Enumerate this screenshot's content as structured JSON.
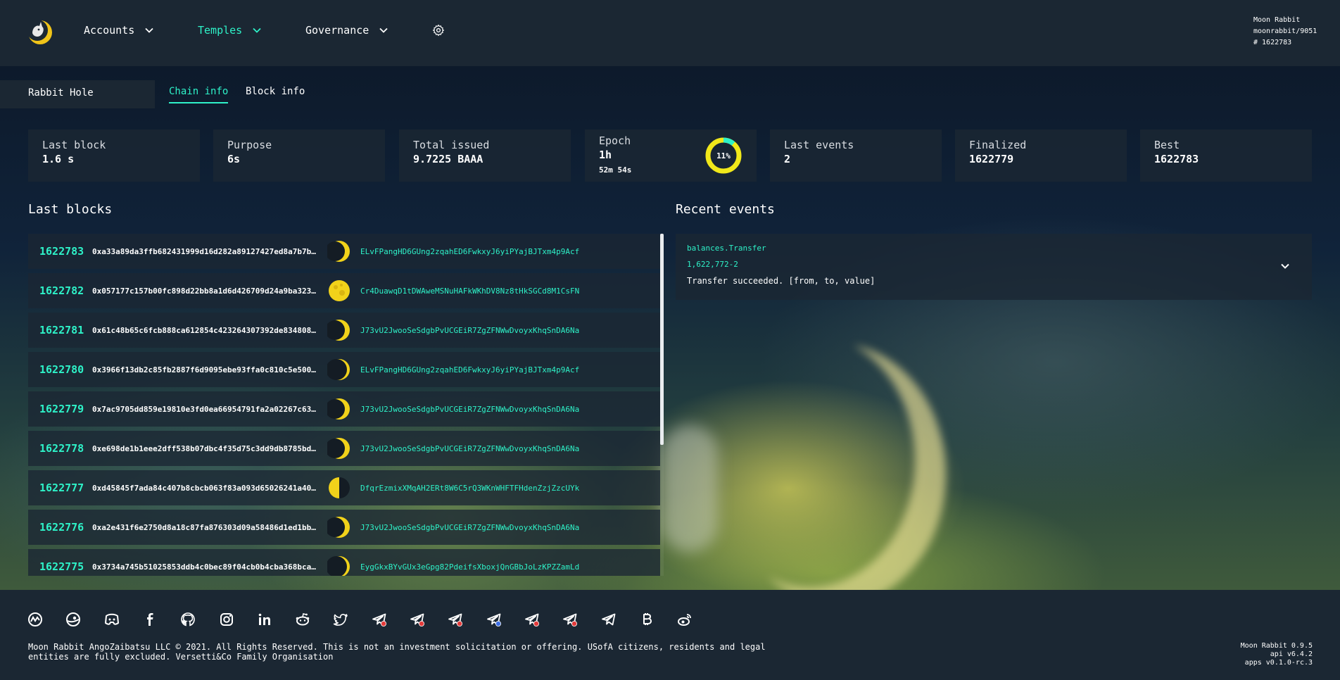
{
  "header": {
    "nav": [
      {
        "label": "Accounts",
        "active": false
      },
      {
        "label": "Temples",
        "active": true
      },
      {
        "label": "Governance",
        "active": false
      }
    ],
    "settings_icon": "gear-icon",
    "node": {
      "name": "Moon Rabbit",
      "version": "moonrabbit/9051",
      "block": "# 1622783"
    }
  },
  "subnav": {
    "section": "Rabbit Hole",
    "tabs": [
      {
        "label": "Chain info",
        "active": true
      },
      {
        "label": "Block info",
        "active": false
      }
    ]
  },
  "summary": [
    {
      "label": "Last block",
      "value": "1.6 s"
    },
    {
      "label": "Purpose",
      "value": "6s"
    },
    {
      "label": "Total issued",
      "value": "9.7225 BAAA"
    },
    {
      "label": "Epoch",
      "value": "1h",
      "sub": "52m 54s",
      "progress": "11%",
      "progress_fraction": 0.11
    },
    {
      "label": "Last events",
      "value": "2"
    },
    {
      "label": "Finalized",
      "value": "1622779"
    },
    {
      "label": "Best",
      "value": "1622783"
    }
  ],
  "last_blocks": {
    "title": "Last blocks",
    "rows": [
      {
        "number": "1622783",
        "hash": "0xa33a89da3ffb682431999d16d282a89127427ed8a7b7b…",
        "moon": "waxing-crescent",
        "author": "ELvFPangHD6GUng2zqahED6FwkxyJ6yiPYajBJTxm4p9Acf"
      },
      {
        "number": "1622782",
        "hash": "0x057177c157b00fc898d22bb8a1d6d426709d24a9ba323…",
        "moon": "full",
        "author": "Cr4DuawqD1tDWAweMSNuHAFkWKhDV8Nz8tHkSGCd8M1CsFN"
      },
      {
        "number": "1622781",
        "hash": "0x61c48b65c6fcb888ca612854c423264307392de834808…",
        "moon": "waxing-crescent",
        "author": "J73vU2JwooSeSdgbPvUCGEiR7ZgZFNWwDvoyxKhqSnDA6Na"
      },
      {
        "number": "1622780",
        "hash": "0x3966f13db2c85fb2887f6d9095ebe93ffa0c810c5e500…",
        "moon": "thin-crescent",
        "author": "ELvFPangHD6GUng2zqahED6FwkxyJ6yiPYajBJTxm4p9Acf"
      },
      {
        "number": "1622779",
        "hash": "0x7ac9705dd859e19810e3fd0ea66954791fa2a02267c63…",
        "moon": "waxing-crescent",
        "author": "J73vU2JwooSeSdgbPvUCGEiR7ZgZFNWwDvoyxKhqSnDA6Na"
      },
      {
        "number": "1622778",
        "hash": "0xe698de1b1eee2dff538b07dbc4f35d75c3dd9db8785bd…",
        "moon": "waxing-crescent",
        "author": "J73vU2JwooSeSdgbPvUCGEiR7ZgZFNWwDvoyxKhqSnDA6Na"
      },
      {
        "number": "1622777",
        "hash": "0xd45845f7ada84c407b8cbcb063f83a093d65026241a40…",
        "moon": "half",
        "author": "DfqrEzmixXMqAH2ERt8W6C5rQ3WKnWHFTFHdenZzjZzcUYk"
      },
      {
        "number": "1622776",
        "hash": "0xa2e431f6e2750d8a18c87fa876303d09a58486d1ed1bb…",
        "moon": "waxing-crescent",
        "author": "J73vU2JwooSeSdgbPvUCGEiR7ZgZFNWwDvoyxKhqSnDA6Na"
      },
      {
        "number": "1622775",
        "hash": "0x3734a745b51025853ddb4c0bec89f04cb0b4cba368bca…",
        "moon": "thin-crescent",
        "author": "EygGkxBYvGUx3eGpg82PdeifsXboxjQnGBbJoLzKPZZamLd"
      }
    ]
  },
  "recent_events": {
    "title": "Recent events",
    "items": [
      {
        "name": "balances.Transfer",
        "id": "1,622,772-2",
        "description": "Transfer succeeded. [from, to, value]"
      }
    ]
  },
  "footer": {
    "social_icons": [
      "coinmarketcap-icon",
      "coingecko-icon",
      "discord-icon",
      "facebook-icon",
      "github-icon",
      "instagram-icon",
      "linkedin-icon",
      "reddit-icon",
      "twitter-icon",
      "telegram-icon",
      "telegram-icon",
      "telegram-icon",
      "telegram-icon",
      "telegram-icon",
      "telegram-icon",
      "telegram-icon",
      "bitcoin-icon",
      "weibo-icon"
    ],
    "legal": "Moon Rabbit AngoZaibatsu LLC © 2021. All Rights Reserved. This is not an investment solicitation or offering. USofA citizens, residents and legal entities are fully excluded. Versetti&Co Family Organisation",
    "versions": {
      "app": "Moon Rabbit 0.9.5",
      "api": "api v6.4.2",
      "apps": "apps v0.1.0-rc.3"
    }
  },
  "colors": {
    "accent": "#2ef2c8",
    "panel": "#1b2733",
    "moon": "#f1d21a"
  }
}
